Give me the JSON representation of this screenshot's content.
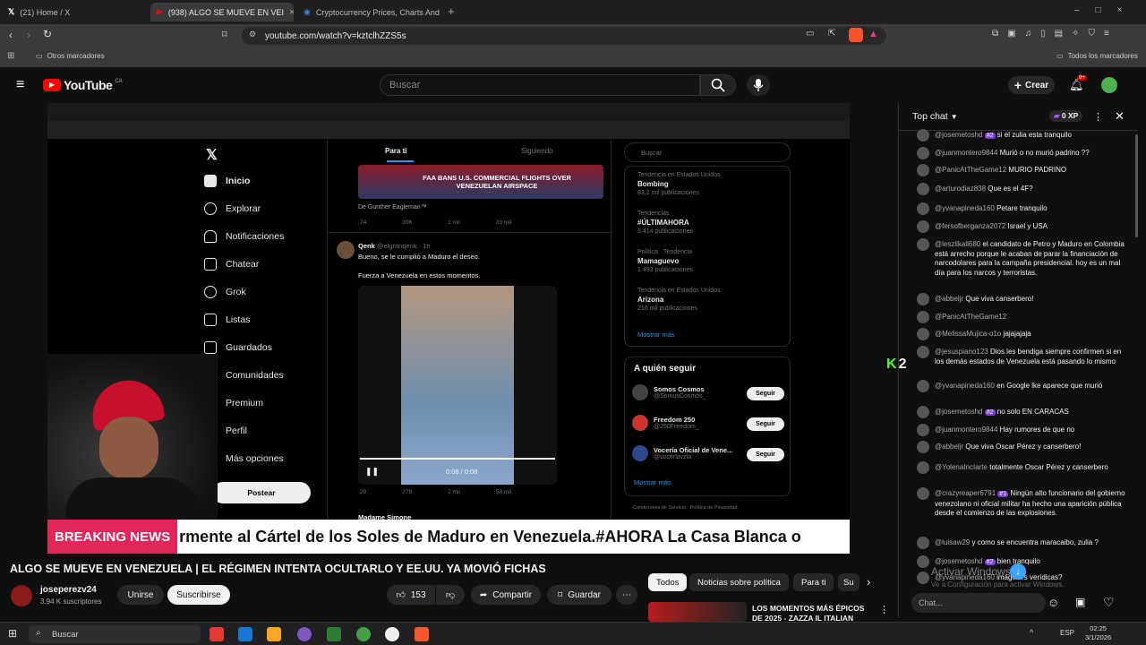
{
  "browser": {
    "tabs": [
      {
        "label": "(21) Home / X"
      },
      {
        "label": "(938) ALGO SE MUEVE EN VEI"
      },
      {
        "label": "Cryptocurrency Prices, Charts And M"
      }
    ],
    "url": "youtube.com/watch?v=kztclhZZS5s",
    "bookmarks_left": "Otros marcadores",
    "bookmarks_right": "Todos los marcadores"
  },
  "youtube": {
    "logo": "YouTube",
    "country": "CA",
    "search_placeholder": "Buscar",
    "create_label": "Crear",
    "notif_count": "9+"
  },
  "video_frame": {
    "x_nav": [
      "Inicio",
      "Explorar",
      "Notificaciones",
      "Chatear",
      "Grok",
      "Listas",
      "Guardados",
      "Comunidades",
      "Premium",
      "Perfil",
      "Más opciones"
    ],
    "post_button": "Postear",
    "tabs": [
      "Para ti",
      "Siguiendo"
    ],
    "tweet1_byline": "De Gunther Eagleman™",
    "tweet1_counts": [
      "74",
      "306",
      "1 mil",
      "33 mil"
    ],
    "news_banner": "FAA BANS U.S. COMMERCIAL FLIGHTS OVER VENEZUELAN AIRSPACE",
    "tweet2_author": "Qenk",
    "tweet2_handle": "@elgranqenk · 1h",
    "tweet2_text1": "Bueno, se le cumplió a Maduro el deseo.",
    "tweet2_text2": "Fuerza a Venezuela en estos momentos.",
    "tweet2_time": "0:08 / 0:08",
    "tweet2_counts": [
      "20",
      "279",
      "2 mil",
      "58 mil"
    ],
    "tweet3_author": "Madame Simone",
    "x_search": "Buscar",
    "trends": [
      {
        "cat": "Tendencia en Estados Unidos",
        "name": "Bombing",
        "count": "83,2 mil publicaciones"
      },
      {
        "cat": "Tendencias",
        "name": "#ÚLTIMAHORA",
        "count": "3.414 publicaciones"
      },
      {
        "cat": "Política · Tendencia",
        "name": "Mamaguevo",
        "count": "1.493 publicaciones"
      },
      {
        "cat": "Tendencia en Estados Unidos",
        "name": "Arizona",
        "count": "210 mil publicaciones"
      }
    ],
    "show_more": "Mostrar más",
    "who_to_follow": "A quién seguir",
    "follow": [
      {
        "name": "Somos Cosmos",
        "handle": "@SomosCosmos_"
      },
      {
        "name": "Freedom 250",
        "handle": "@250Freedom_"
      },
      {
        "name": "Vocería Oficial de Vene...",
        "handle": "@vocerlavzla"
      }
    ],
    "follow_label": "Seguir",
    "show_more2": "Mostrar más",
    "footer": "Condiciones de Servicio   Política de Privacidad",
    "breaking_label": "BREAKING NEWS",
    "breaking_text": "rmente al Cártel de los Soles de Maduro en Venezuela.#AHORA La Casa Blanca o"
  },
  "video_info": {
    "title": "ALGO SE MUEVE EN VENEZUELA | EL RÉGIMEN INTENTA OCULTARLO Y EE.UU. YA MOVIÓ FICHAS",
    "channel": "joseperezv24",
    "subs": "3.94 K suscriptores",
    "join": "Unirse",
    "subscribe": "Suscribirse",
    "likes": "153",
    "share": "Compartir",
    "save": "Guardar"
  },
  "chips": [
    "Todos",
    "Noticias sobre política",
    "Para ti",
    "Su"
  ],
  "rec_title": "LOS MOMENTOS MÁS ÉPICOS DE 2025 - ZAZZA IL ITALIAN",
  "chat": {
    "header": "Top chat",
    "xp": "0 XP",
    "messages": [
      {
        "author": "@josemetoshd",
        "badge": "#2",
        "text": "si el zulia esta tranquilo"
      },
      {
        "author": "@juanmontero9844",
        "text": "Murió o no murió padrino ??"
      },
      {
        "author": "@PanicAtTheGame12",
        "text": "MURIO PADRINO"
      },
      {
        "author": "@arturodiaz838",
        "text": "Que es el 4F?"
      },
      {
        "author": "@yvanapineda160",
        "text": "Petare tranquilo"
      },
      {
        "author": "@fersofberganza2072",
        "text": "Israel y USA"
      },
      {
        "author": "@leszlikall680",
        "text": "el candidato de Petro y Maduro en Colombia está arrecho porque le acaban de parar la financiación de narcodolares para la campaña presidencial. hoy es un mal día para los narcos y terroristas."
      },
      {
        "author": "@abbeljr",
        "text": "Que viva canserbero!"
      },
      {
        "author": "@PanicAtTheGame12",
        "text": ""
      },
      {
        "author": "@MelissaMujica-o1o",
        "text": "jajajajaja"
      },
      {
        "author": "@jesuspiano123",
        "text": "Dios les bendiga siempre confirmen si en los demás estados de Venezuela está pasando lo mismo"
      },
      {
        "author": "@yvanapineda160",
        "text": "en Google lke aparece que murió"
      },
      {
        "author": "@josemetoshd",
        "badge": "#2",
        "text": "no solo EN CARACAS"
      },
      {
        "author": "@juanmontero9844",
        "text": "Hay rumores de que no"
      },
      {
        "author": "@abbeljr",
        "text": "Que viva Oscar Pérez y canserbero!"
      },
      {
        "author": "@YolenaIncIarte",
        "text": "totalmente Oscar Pérez y canserbero"
      },
      {
        "author": "@crazyreaper6791",
        "badge": "#1",
        "text": "Ningún alto funcionario del gobierno venezolano ni oficial militar ha hecho una aparición pública desde el comienzo de las explosiones."
      },
      {
        "author": "@luisaw29",
        "text": "y como se encuentra maracaibo, zulia ?"
      },
      {
        "author": "@josemetoshd",
        "badge": "#2",
        "text": "bien tranquilo"
      },
      {
        "author": "@yvanapineda160",
        "text": "imágenes verídicas?"
      }
    ],
    "input_placeholder": "Chat...",
    "overlay_text": "2",
    "watermark": "Activar Windows",
    "watermark_sub": "Ve a Configuración para activar Windows."
  },
  "taskbar": {
    "search": "Buscar",
    "lang": "ESP",
    "time": "02:25",
    "date": "3/1/2026"
  }
}
